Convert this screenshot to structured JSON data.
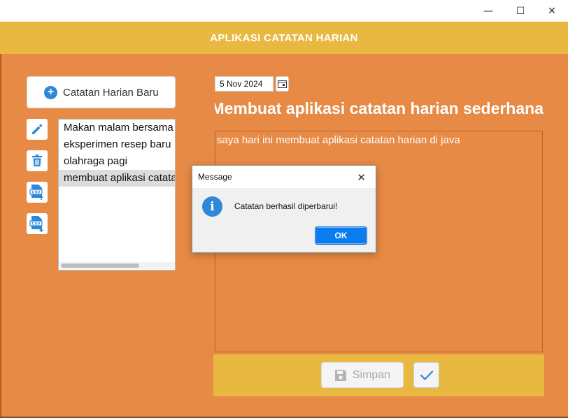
{
  "window": {
    "minimize_glyph": "—",
    "maximize_glyph": "☐",
    "close_glyph": "✕"
  },
  "header": {
    "title": "APLIKASI CATATAN HARIAN"
  },
  "sidebar": {
    "new_button_label": "Catatan Harian Baru",
    "actions": [
      "pencil-icon",
      "trash-icon",
      "csv-export-icon",
      "csv-import-icon"
    ]
  },
  "entries": [
    "Makan malam bersama",
    "eksperimen resep baru",
    "olahraga pagi",
    "membuat aplikasi catatan"
  ],
  "selected_entry_index": 3,
  "editor": {
    "date": "5 Nov 2024",
    "title": "Membuat aplikasi catatan harian sederhana",
    "body": "saya hari ini membuat aplikasi catatan harian di java"
  },
  "footer": {
    "save_label": "Simpan",
    "save_enabled": false
  },
  "dialog": {
    "title": "Message",
    "message": "Catatan berhasil diperbarui!",
    "ok_label": "OK",
    "icon_glyph": "i"
  },
  "colors": {
    "background": "#e68a45",
    "header": "#e8b840",
    "accent": "#2f87d8",
    "ok_button": "#0a7cf0"
  }
}
